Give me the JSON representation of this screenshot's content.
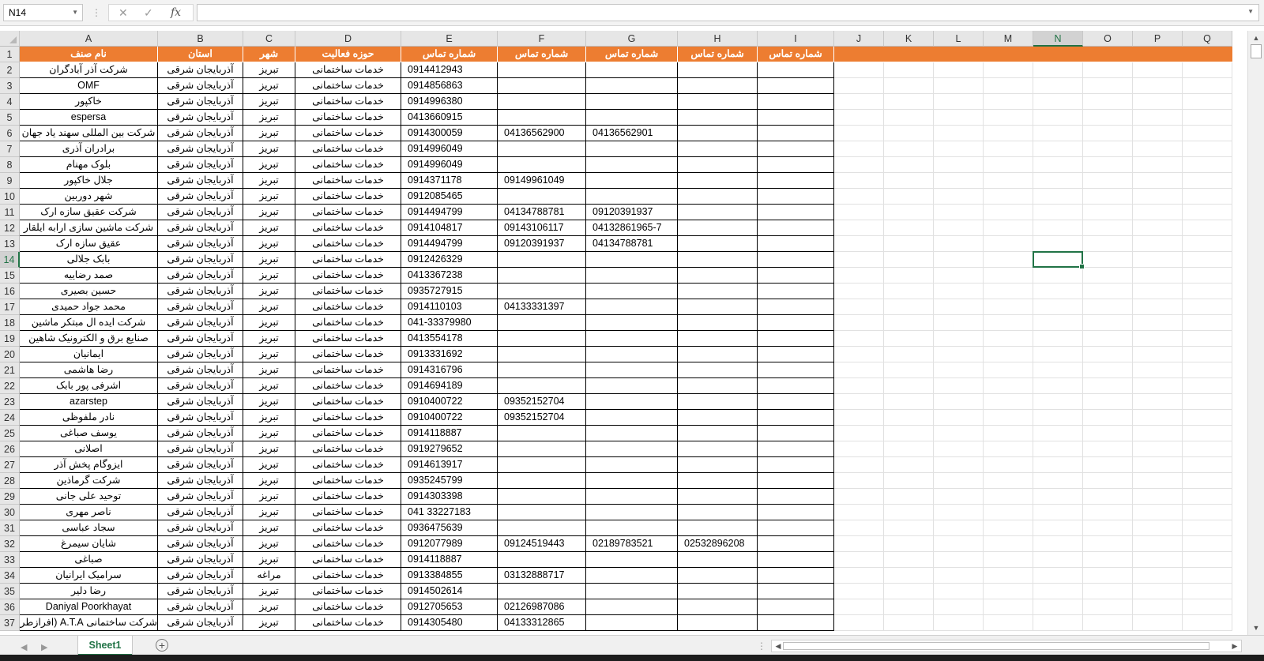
{
  "formula_bar": {
    "name_box": "N14",
    "cancel_icon": "✕",
    "enter_icon": "✓",
    "fx_label": "fx",
    "formula": ""
  },
  "selected_cell": {
    "col": "N",
    "row": 14
  },
  "columns": [
    "A",
    "B",
    "C",
    "D",
    "E",
    "F",
    "G",
    "H",
    "I",
    "J",
    "K",
    "L",
    "M",
    "N",
    "O",
    "P",
    "Q"
  ],
  "header_row": [
    "نام صنف",
    "استان",
    "شهر",
    "حوزه فعالیت",
    "شماره تماس",
    "شماره تماس",
    "شماره تماس",
    "شماره تماس",
    "شماره تماس"
  ],
  "rows": [
    [
      "شرکت آذر آبادگران",
      "آذربایجان شرقی",
      "تبریز",
      "خدمات ساختمانی",
      "0914412943",
      "",
      "",
      "",
      ""
    ],
    [
      "OMF",
      "آذربایجان شرقی",
      "تبریز",
      "خدمات ساختمانی",
      "0914856863",
      "",
      "",
      "",
      ""
    ],
    [
      "خاکپور",
      "آذربایجان شرقی",
      "تبریز",
      "خدمات ساختمانی",
      "0914996380",
      "",
      "",
      "",
      ""
    ],
    [
      "espersa",
      "آذربایجان شرقی",
      "تبریز",
      "خدمات ساختمانی",
      "0413660915",
      "",
      "",
      "",
      ""
    ],
    [
      "شرکت بین المللی سهند یاد جهان",
      "آذربایجان شرقی",
      "تبریز",
      "خدمات ساختمانی",
      "0914300059",
      "04136562900",
      "04136562901",
      "",
      ""
    ],
    [
      "برادران آذری",
      "آذربایجان شرقی",
      "تبریز",
      "خدمات ساختمانی",
      "0914996049",
      "",
      "",
      "",
      ""
    ],
    [
      "بلوک مهنام",
      "آذربایجان شرقی",
      "تبریز",
      "خدمات ساختمانی",
      "0914996049",
      "",
      "",
      "",
      ""
    ],
    [
      "جلال خاکپور",
      "آذربایجان شرقی",
      "تبریز",
      "خدمات ساختمانی",
      "0914371178",
      "09149961049",
      "",
      "",
      ""
    ],
    [
      "شهر دوربین",
      "آذربایجان شرقی",
      "تبریز",
      "خدمات ساختمانی",
      "0912085465",
      "",
      "",
      "",
      ""
    ],
    [
      "شرکت عقیق سازه ارک",
      "آذربایجان شرقی",
      "تبریز",
      "خدمات ساختمانی",
      "0914494799",
      "04134788781",
      "09120391937",
      "",
      ""
    ],
    [
      "شرکت ماشین سازی ارابه ایلقار",
      "آذربایجان شرقی",
      "تبریز",
      "خدمات ساختمانی",
      "0914104817",
      "09143106117",
      "04132861965-7",
      "",
      ""
    ],
    [
      "عقیق سازه ارک",
      "آذربایجان شرقی",
      "تبریز",
      "خدمات ساختمانی",
      "0914494799",
      "09120391937",
      "04134788781",
      "",
      ""
    ],
    [
      "بابک جلالی",
      "آذربایجان شرقی",
      "تبریز",
      "خدمات ساختمانی",
      "0912426329",
      "",
      "",
      "",
      ""
    ],
    [
      "صمد رضاییه",
      "آذربایجان شرقی",
      "تبریز",
      "خدمات ساختمانی",
      "0413367238",
      "",
      "",
      "",
      ""
    ],
    [
      "حسین بصیری",
      "آذربایجان شرقی",
      "تبریز",
      "خدمات ساختمانی",
      "0935727915",
      "",
      "",
      "",
      ""
    ],
    [
      "محمد جواد حمیدی",
      "آذربایجان شرقی",
      "تبریز",
      "خدمات ساختمانی",
      "0914110103",
      "04133331397",
      "",
      "",
      ""
    ],
    [
      "شرکت ایده ال مبتکر ماشین",
      "آذربایجان شرقی",
      "تبریز",
      "خدمات ساختمانی",
      "041-33379980",
      "",
      "",
      "",
      ""
    ],
    [
      "صنایع برق و الکترونیک شاهین",
      "آذربایجان شرقی",
      "تبریز",
      "خدمات ساختمانی",
      "0413554178",
      "",
      "",
      "",
      ""
    ],
    [
      "ایمانیان",
      "آذربایجان شرقی",
      "تبریز",
      "خدمات ساختمانی",
      "0913331692",
      "",
      "",
      "",
      ""
    ],
    [
      "رضا هاشمی",
      "آذربایجان شرقی",
      "تبریز",
      "خدمات ساختمانی",
      "0914316796",
      "",
      "",
      "",
      ""
    ],
    [
      "اشرفی پور بابک",
      "آذربایجان شرقی",
      "تبریز",
      "خدمات ساختمانی",
      "0914694189",
      "",
      "",
      "",
      ""
    ],
    [
      "azarstep",
      "آذربایجان شرقی",
      "تبریز",
      "خدمات ساختمانی",
      "0910400722",
      "09352152704",
      "",
      "",
      ""
    ],
    [
      "نادر ملفوظی",
      "آذربایجان شرقی",
      "تبریز",
      "خدمات ساختمانی",
      "0910400722",
      "09352152704",
      "",
      "",
      ""
    ],
    [
      "یوسف صباغی",
      "آذربایجان شرقی",
      "تبریز",
      "خدمات ساختمانی",
      "0914118887",
      "",
      "",
      "",
      ""
    ],
    [
      "اصلانی",
      "آذربایجان شرقی",
      "تبریز",
      "خدمات ساختمانی",
      "0919279652",
      "",
      "",
      "",
      ""
    ],
    [
      "ایزوگام پخش آذر",
      "آذربایجان شرقی",
      "تبریز",
      "خدمات ساختمانی",
      "0914613917",
      "",
      "",
      "",
      ""
    ],
    [
      "شرکت گرماذین",
      "آذربایجان شرقی",
      "تبریز",
      "خدمات ساختمانی",
      "0935245799",
      "",
      "",
      "",
      ""
    ],
    [
      "توحید علی جانی",
      "آذربایجان شرقی",
      "تبریز",
      "خدمات ساختمانی",
      "0914303398",
      "",
      "",
      "",
      ""
    ],
    [
      "ناصر مهری",
      "آذربایجان شرقی",
      "تبریز",
      "خدمات ساختمانی",
      "041 33227183",
      "",
      "",
      "",
      ""
    ],
    [
      "سجاد عباسی",
      "آذربایجان شرقی",
      "تبریز",
      "خدمات ساختمانی",
      "0936475639",
      "",
      "",
      "",
      ""
    ],
    [
      "شایان سیمرغ",
      "آذربایجان شرقی",
      "تبریز",
      "خدمات ساختمانی",
      "0912077989",
      "09124519443",
      "02189783521",
      "02532896208",
      ""
    ],
    [
      "صباغی",
      "آذربایجان شرقی",
      "تبریز",
      "خدمات ساختمانی",
      "0914118887",
      "",
      "",
      "",
      ""
    ],
    [
      "سرامیک ایرانیان",
      "آذربایجان شرقی",
      "مراغه",
      "خدمات ساختمانی",
      "0913384855",
      "03132888717",
      "",
      "",
      ""
    ],
    [
      "رضا دلیر",
      "آذربایجان شرقی",
      "تبریز",
      "خدمات ساختمانی",
      "0914502614",
      "",
      "",
      "",
      ""
    ],
    [
      "Daniyal Poorkhayat",
      "آذربایجان شرقی",
      "تبریز",
      "خدمات ساختمانی",
      "0912705653",
      "02126987086",
      "",
      "",
      ""
    ],
    [
      "شرکت ساختمانی A.T.A (افرازطرح آذر)",
      "آذربایجان شرقی",
      "تبریز",
      "خدمات ساختمانی",
      "0914305480",
      "04133312865",
      "",
      "",
      ""
    ]
  ],
  "sheet_tabs": [
    "Sheet1"
  ],
  "add_sheet_icon": "+"
}
